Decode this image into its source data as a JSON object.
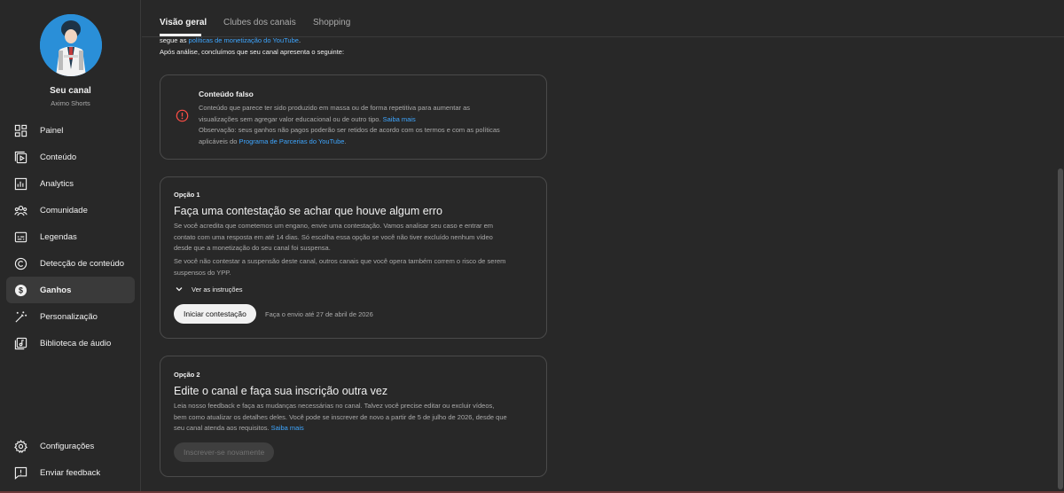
{
  "sidebar": {
    "channel_title": "Seu canal",
    "channel_handle": "Aximo Shorts",
    "items": [
      {
        "label": "Painel",
        "icon": "dashboard-icon"
      },
      {
        "label": "Conteúdo",
        "icon": "content-icon"
      },
      {
        "label": "Analytics",
        "icon": "analytics-icon"
      },
      {
        "label": "Comunidade",
        "icon": "community-icon"
      },
      {
        "label": "Legendas",
        "icon": "subtitles-icon"
      },
      {
        "label": "Detecção de conteúdo",
        "icon": "copyright-icon"
      },
      {
        "label": "Ganhos",
        "icon": "earn-icon",
        "active": true
      },
      {
        "label": "Personalização",
        "icon": "customization-icon"
      },
      {
        "label": "Biblioteca de áudio",
        "icon": "audio-library-icon"
      }
    ],
    "bottom_items": [
      {
        "label": "Configurações",
        "icon": "settings-icon"
      },
      {
        "label": "Enviar feedback",
        "icon": "feedback-icon"
      }
    ]
  },
  "tabs": [
    {
      "label": "Visão geral",
      "active": true
    },
    {
      "label": "Clubes dos canais"
    },
    {
      "label": "Shopping"
    }
  ],
  "intro": {
    "line1_prefix": "segue as ",
    "line1_link": "políticas de monetização do YouTube",
    "line1_suffix": ".",
    "line2": "Após análise, concluímos que seu canal apresenta o seguinte:"
  },
  "violation": {
    "title": "Conteúdo falso",
    "desc_line1": "Conteúdo que parece ter sido produzido em massa ou de forma repetitiva para aumentar as",
    "desc_line2_prefix": "visualizações sem agregar valor educacional ou de outro tipo. ",
    "desc_line2_link": "Saiba mais",
    "note_line1": "Observação: seus ganhos não pagos poderão ser retidos de acordo com os termos e com as políticas",
    "note_line2_prefix": "aplicáveis do ",
    "note_line2_link": "Programa de Parcerias do YouTube",
    "note_line2_suffix": ".",
    "icon": "error-icon",
    "icon_color": "#ff4e45"
  },
  "option1": {
    "label": "Opção 1",
    "title": "Faça uma contestação se achar que houve algum erro",
    "p1_line1": "Se você acredita que cometemos um engano, envie uma contestação. Vamos analisar seu caso e entrar em",
    "p1_line2": "contato com uma resposta em até 14 dias. Só escolha essa opção se você não tiver excluído nenhum vídeo",
    "p1_line3": "desde que a monetização do seu canal foi suspensa.",
    "p2_line1": "Se você não contestar a suspensão deste canal, outros canais que você opera também correm o risco de serem",
    "p2_line2": "suspensos do YPP.",
    "expand_label": "Ver as instruções",
    "button_label": "Iniciar contestação",
    "deadline_note": "Faça o envio até 27 de abril de 2026"
  },
  "option2": {
    "label": "Opção 2",
    "title": "Edite o canal e faça sua inscrição outra vez",
    "line1": "Leia nosso feedback e faça as mudanças necessárias no canal. Talvez você precise editar ou excluir vídeos,",
    "line2": "bem como atualizar os detalhes deles. Você pode se inscrever de novo a partir de 5 de julho de 2026, desde que",
    "line3_prefix": "seu canal atenda aos requisitos. ",
    "line3_link": "Saiba mais",
    "button_label": "Inscrever-se novamente"
  },
  "colors": {
    "background": "#282828",
    "link": "#3ea6ff",
    "error": "#ff4e45"
  }
}
